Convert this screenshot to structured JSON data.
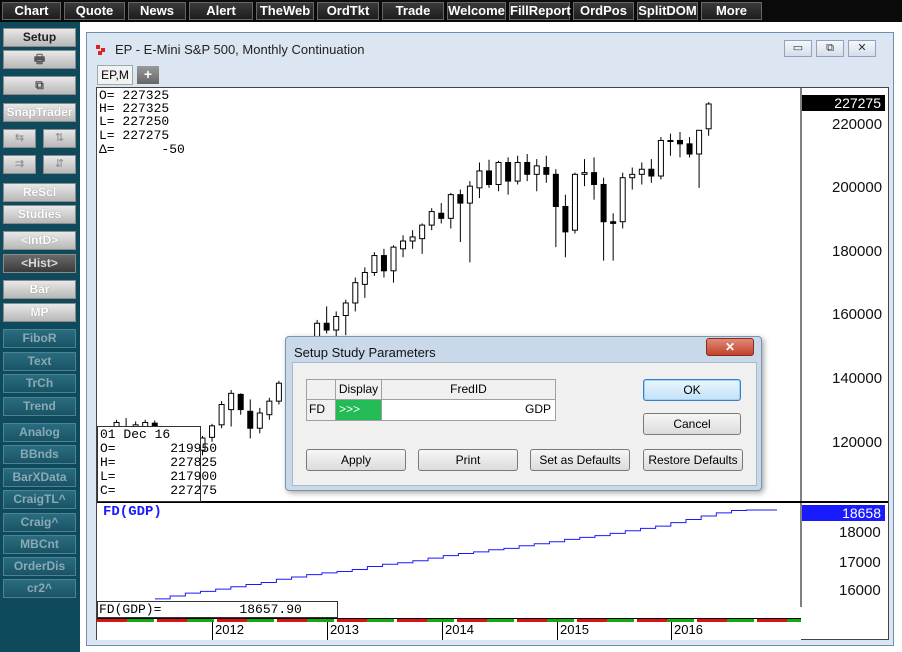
{
  "topbar": {
    "items": [
      "Chart",
      "Quote",
      "News",
      "Alert",
      "TheWeb",
      "OrdTkt",
      "Trade",
      "Welcome",
      "FillReport",
      "OrdPos",
      "SplitDOM",
      "More"
    ]
  },
  "sidebar": {
    "setup": "Setup",
    "snaptrader": "SnapTrader",
    "items": [
      "ReScl",
      "Studies",
      "<IntD>",
      "<Hist>",
      "Bar",
      "MP",
      "FiboR",
      "Text",
      "TrCh",
      "Trend",
      "Analog",
      "BBnds",
      "BarXData",
      "CraigTL^",
      "Craig^",
      "MBCnt",
      "OrderDis",
      "cr2^"
    ]
  },
  "window": {
    "title": "EP - E-Mini S&P 500, Monthly Continuation",
    "tab": "EP,M",
    "tab_add": "+",
    "controls": {
      "minimize": "▭",
      "restore": "⧉",
      "close": "✕"
    }
  },
  "chart": {
    "cursor_ohlc": [
      "O= 227325",
      "H= 227325",
      "L= 227250",
      "L= 227275",
      "Δ=      -50"
    ],
    "bar_info": [
      "01 Dec 16",
      "O=       219950",
      "H=       227825",
      "L=       217900",
      "C=       227275"
    ],
    "last_price": "227275",
    "fd_last": "18658",
    "fd_title": "FD(GDP)",
    "fd_value": "FD(GDP)=          18657.90",
    "colors": {
      "last_price_bg": "#000000",
      "fd_badge_bg": "#1a1aff",
      "fd_line": "#1a1aff",
      "candle": "#000000"
    },
    "price_axis": [
      "220000",
      "200000",
      "180000",
      "160000",
      "140000",
      "120000"
    ],
    "fd_axis": [
      "18000",
      "17000",
      "16000"
    ],
    "years": [
      "2012",
      "2013",
      "2014",
      "2015",
      "2016"
    ]
  },
  "chart_data": [
    {
      "type": "candlestick",
      "title": "EP - E-Mini S&P 500, Monthly Continuation",
      "ylim": [
        110000,
        232000
      ],
      "x_labels": [
        "2012",
        "2013",
        "2014",
        "2015",
        "2016"
      ],
      "candles": [
        {
          "o": 128500,
          "h": 131500,
          "l": 126000,
          "c": 130800
        },
        {
          "o": 129500,
          "h": 134000,
          "l": 127000,
          "c": 133200
        },
        {
          "o": 131800,
          "h": 134500,
          "l": 129500,
          "c": 130200
        },
        {
          "o": 130800,
          "h": 133500,
          "l": 126000,
          "c": 132500
        },
        {
          "o": 131500,
          "h": 134000,
          "l": 129000,
          "c": 133200
        },
        {
          "o": 133000,
          "h": 133800,
          "l": 126500,
          "c": 127800
        },
        {
          "o": 127500,
          "h": 130800,
          "l": 124000,
          "c": 125200
        },
        {
          "o": 125800,
          "h": 129000,
          "l": 121500,
          "c": 128300
        },
        {
          "o": 128000,
          "h": 131500,
          "l": 124500,
          "c": 127200
        },
        {
          "o": 127000,
          "h": 130000,
          "l": 122000,
          "c": 123500
        },
        {
          "o": 125000,
          "h": 129200,
          "l": 123500,
          "c": 128600
        },
        {
          "o": 128800,
          "h": 132800,
          "l": 127500,
          "c": 132200
        },
        {
          "o": 132500,
          "h": 139500,
          "l": 131500,
          "c": 138500
        },
        {
          "o": 137000,
          "h": 142800,
          "l": 132000,
          "c": 141800
        },
        {
          "o": 141500,
          "h": 141800,
          "l": 135500,
          "c": 137000
        },
        {
          "o": 136500,
          "h": 140000,
          "l": 128500,
          "c": 131500
        },
        {
          "o": 131500,
          "h": 137500,
          "l": 130000,
          "c": 136000
        },
        {
          "o": 135500,
          "h": 140500,
          "l": 134000,
          "c": 139500
        },
        {
          "o": 139500,
          "h": 145500,
          "l": 138500,
          "c": 144800
        },
        {
          "o": 144800,
          "h": 153500,
          "l": 143800,
          "c": 152500
        },
        {
          "o": 152000,
          "h": 156500,
          "l": 150500,
          "c": 154500
        },
        {
          "o": 154000,
          "h": 158500,
          "l": 152000,
          "c": 157000
        },
        {
          "o": 157000,
          "h": 163500,
          "l": 156000,
          "c": 162500
        },
        {
          "o": 162500,
          "h": 167500,
          "l": 159500,
          "c": 160500
        },
        {
          "o": 160500,
          "h": 166000,
          "l": 157500,
          "c": 164500
        },
        {
          "o": 164800,
          "h": 169500,
          "l": 159000,
          "c": 168500
        },
        {
          "o": 168500,
          "h": 176000,
          "l": 166000,
          "c": 174500
        },
        {
          "o": 174000,
          "h": 179000,
          "l": 170000,
          "c": 177500
        },
        {
          "o": 177500,
          "h": 183500,
          "l": 176500,
          "c": 182500
        },
        {
          "o": 182500,
          "h": 184500,
          "l": 176000,
          "c": 178000
        },
        {
          "o": 178000,
          "h": 185500,
          "l": 174500,
          "c": 185000
        },
        {
          "o": 184500,
          "h": 188500,
          "l": 182000,
          "c": 186800
        },
        {
          "o": 186800,
          "h": 190000,
          "l": 184500,
          "c": 188000
        },
        {
          "o": 187500,
          "h": 192000,
          "l": 183000,
          "c": 191500
        },
        {
          "o": 191500,
          "h": 196500,
          "l": 190000,
          "c": 195500
        },
        {
          "o": 195000,
          "h": 198000,
          "l": 192000,
          "c": 193500
        },
        {
          "o": 193500,
          "h": 201000,
          "l": 190500,
          "c": 200500
        },
        {
          "o": 200500,
          "h": 202000,
          "l": 186500,
          "c": 198000
        },
        {
          "o": 198000,
          "h": 204500,
          "l": 180500,
          "c": 203000
        },
        {
          "o": 202500,
          "h": 210000,
          "l": 199500,
          "c": 207500
        },
        {
          "o": 207500,
          "h": 210800,
          "l": 202500,
          "c": 203500
        },
        {
          "o": 203500,
          "h": 210500,
          "l": 201500,
          "c": 210000
        },
        {
          "o": 210000,
          "h": 211500,
          "l": 200500,
          "c": 204500
        },
        {
          "o": 204500,
          "h": 212000,
          "l": 203500,
          "c": 210000
        },
        {
          "o": 210000,
          "h": 212500,
          "l": 204500,
          "c": 206500
        },
        {
          "o": 206500,
          "h": 211000,
          "l": 201500,
          "c": 209000
        },
        {
          "o": 208500,
          "h": 212000,
          "l": 204000,
          "c": 206500
        },
        {
          "o": 206500,
          "h": 208000,
          "l": 185000,
          "c": 197000
        },
        {
          "o": 197000,
          "h": 200500,
          "l": 182000,
          "c": 189500
        },
        {
          "o": 190000,
          "h": 207000,
          "l": 189000,
          "c": 206500
        },
        {
          "o": 206500,
          "h": 211000,
          "l": 203000,
          "c": 207000
        },
        {
          "o": 207000,
          "h": 211500,
          "l": 199000,
          "c": 203500
        },
        {
          "o": 203500,
          "h": 205500,
          "l": 181000,
          "c": 192500
        },
        {
          "o": 192500,
          "h": 195000,
          "l": 181000,
          "c": 192000
        },
        {
          "o": 192500,
          "h": 207000,
          "l": 190500,
          "c": 205500
        },
        {
          "o": 205500,
          "h": 208500,
          "l": 202000,
          "c": 206500
        },
        {
          "o": 206500,
          "h": 210000,
          "l": 203500,
          "c": 208000
        },
        {
          "o": 208000,
          "h": 211000,
          "l": 204000,
          "c": 206000
        },
        {
          "o": 206000,
          "h": 217500,
          "l": 205000,
          "c": 216500
        },
        {
          "o": 216500,
          "h": 218500,
          "l": 212000,
          "c": 216500
        },
        {
          "o": 216500,
          "h": 219000,
          "l": 211500,
          "c": 215500
        },
        {
          "o": 215500,
          "h": 217500,
          "l": 211500,
          "c": 212500
        },
        {
          "o": 212500,
          "h": 219500,
          "l": 202500,
          "c": 219500
        },
        {
          "o": 219950,
          "h": 227825,
          "l": 217900,
          "c": 227275
        }
      ]
    },
    {
      "type": "line",
      "title": "FD(GDP)",
      "ylim": [
        15300,
        18900
      ],
      "series": [
        {
          "name": "FD(GDP)",
          "values": [
            15580,
            15680,
            15780,
            15840,
            15920,
            16000,
            16080,
            16150,
            16260,
            16340,
            16420,
            16480,
            16530,
            16600,
            16700,
            16780,
            16830,
            16900,
            16990,
            17080,
            17150,
            17210,
            17280,
            17330,
            17420,
            17490,
            17560,
            17640,
            17710,
            17770,
            17850,
            17940,
            18020,
            18100,
            18220,
            18330,
            18450,
            18560,
            18640,
            18658,
            18658,
            18658
          ]
        }
      ]
    }
  ],
  "dialog": {
    "title": "Setup Study Parameters",
    "close": "✕",
    "col_display": "Display",
    "col_fredid": "FredID",
    "row_label": "FD",
    "row_display": ">>>",
    "row_fredid": "GDP",
    "ok": "OK",
    "cancel": "Cancel",
    "apply": "Apply",
    "print": "Print",
    "set_defaults": "Set as Defaults",
    "restore_defaults": "Restore Defaults",
    "display_color": "#22bb55"
  }
}
